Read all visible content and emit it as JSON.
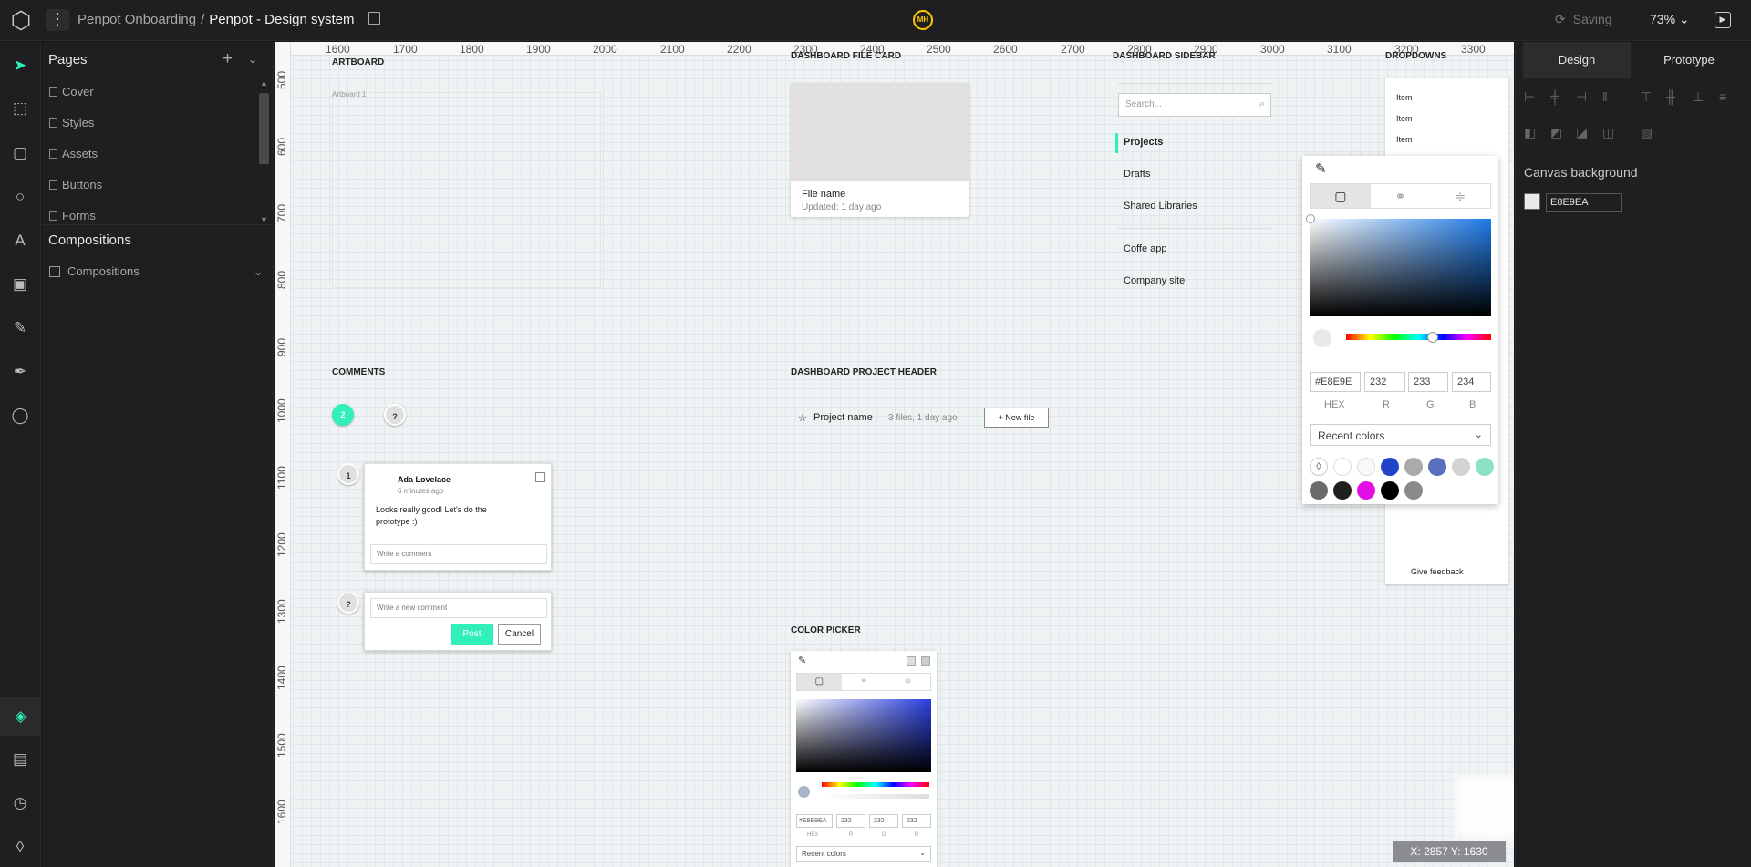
{
  "topbar": {
    "project": "Penpot Onboarding",
    "separator": "/",
    "file": "Penpot - Design system",
    "avatar_initials": "MH",
    "status": "Saving",
    "zoom": "73%"
  },
  "sidebar": {
    "pages_title": "Pages",
    "pages": [
      "Cover",
      "Styles",
      "Assets",
      "Buttons",
      "Forms"
    ],
    "compositions_title": "Compositions",
    "composition_item": "Compositions"
  },
  "rulers": {
    "top": [
      "1600",
      "1700",
      "1800",
      "1900",
      "2000",
      "2100",
      "2200",
      "2300",
      "2400",
      "2500",
      "2600",
      "2700",
      "2800",
      "2900",
      "3000",
      "3100",
      "3200",
      "3300"
    ],
    "left": [
      "500",
      "600",
      "700",
      "800",
      "900",
      "1000",
      "1100",
      "1200",
      "1300",
      "1400",
      "1500",
      "1600"
    ]
  },
  "canvas": {
    "artboard": {
      "title": "ARTBOARD",
      "label": "Artboard 1"
    },
    "file_card": {
      "title": "DASHBOARD FILE CARD",
      "name": "File name",
      "updated": "Updated: 1 day ago"
    },
    "dash_sidebar": {
      "title": "DASHBOARD SIDEBAR",
      "search_placeholder": "Search...",
      "items": [
        "Projects",
        "Drafts",
        "Shared Libraries",
        "Coffe app",
        "Company site"
      ]
    },
    "dropdowns": {
      "title": "DROPDOWNS",
      "items": [
        "Item",
        "Item",
        "Item"
      ],
      "footer_item": "Give feedback"
    },
    "comments": {
      "title": "COMMENTS",
      "bubble_green": "2",
      "bubble_gray": "?",
      "thread_bubble": "1",
      "author": "Ada Lovelace",
      "time": "6 minutes ago",
      "text": "Looks really good! Let's do the prototype :)",
      "reply_placeholder": "Write a comment",
      "new_bubble": "?",
      "new_placeholder": "Write a new comment",
      "post": "Post",
      "cancel": "Cancel"
    },
    "project_header": {
      "title": "DASHBOARD PROJECT HEADER",
      "name": "Project name",
      "meta": "3 files, 1 day ago",
      "new_file": "+ New file"
    },
    "color_picker_board": {
      "title": "COLOR PICKER",
      "hex": "#E8E9EA",
      "r": "232",
      "g": "232",
      "b": "232",
      "labels": [
        "HEX",
        "R",
        "G",
        "B"
      ],
      "recent": "Recent colors"
    },
    "coords": "X: 2857 Y: 1630"
  },
  "picker": {
    "hex": "#E8E9E",
    "r": "232",
    "g": "233",
    "b": "234",
    "labels": [
      "HEX",
      "R",
      "G",
      "B"
    ],
    "recent_label": "Recent colors",
    "recent_colors": [
      "#ffffff",
      "#f8f8f8",
      "#2143c8",
      "#aaaaaa",
      "#5a6fbd",
      "#d3d3d3",
      "#8ce3c4",
      "#6b6b6b",
      "#1f1f1f",
      "#e10ee6",
      "#000000",
      "#8a8a8a"
    ]
  },
  "right_panel": {
    "tab_design": "Design",
    "tab_prototype": "Prototype",
    "canvas_bg_title": "Canvas background",
    "canvas_bg_hex": "E8E9EA"
  }
}
